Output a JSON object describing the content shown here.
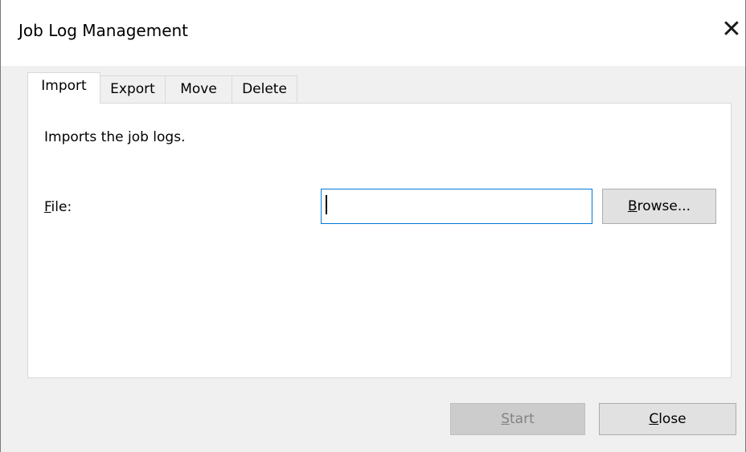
{
  "window": {
    "title": "Job Log Management",
    "close_glyph": "✕"
  },
  "tabs": [
    {
      "label": "Import",
      "active": true
    },
    {
      "label": "Export",
      "active": false
    },
    {
      "label": "Move",
      "active": false
    },
    {
      "label": "Delete",
      "active": false
    }
  ],
  "import_panel": {
    "description": "Imports the job logs.",
    "file_label_mnemonic": "F",
    "file_label_rest": "ile:",
    "file_value": "",
    "browse_mnemonic": "B",
    "browse_rest": "rowse..."
  },
  "footer": {
    "start_mnemonic": "S",
    "start_rest": "tart",
    "start_enabled": false,
    "close_mnemonic": "C",
    "close_rest": "lose"
  },
  "colors": {
    "focus_border": "#0078d7",
    "button_face": "#e1e1e1",
    "disabled_button_face": "#cccccc",
    "disabled_text": "#838383",
    "dialog_background": "#f0f0f0"
  }
}
